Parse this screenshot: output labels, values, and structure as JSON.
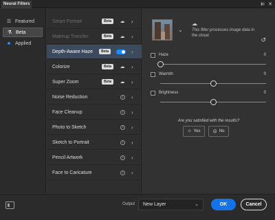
{
  "window": {
    "title": "Neural Filters",
    "menu_icon": "⇇",
    "close_icon": "✕"
  },
  "sidebar": {
    "items": [
      {
        "label": "Featured",
        "icon": "list-icon",
        "active": false
      },
      {
        "label": "Beta",
        "icon": "flask-icon",
        "active": true
      },
      {
        "label": "Applied",
        "icon": "dot-icon",
        "active": false
      }
    ]
  },
  "filters": [
    {
      "label": "Smart Portrait",
      "state": "badge-download",
      "badge": "Beta",
      "dim": true
    },
    {
      "label": "Makeup Transfer",
      "state": "badge-download",
      "badge": "Beta",
      "dim": true
    },
    {
      "label": "Depth-Aware Haze",
      "state": "badge-toggle",
      "badge": "Beta",
      "selected": true
    },
    {
      "label": "Colorize",
      "state": "badge-download",
      "badge": "Beta"
    },
    {
      "label": "Super Zoom",
      "state": "badge-download",
      "badge": "Beta"
    },
    {
      "label": "Noise Reduction",
      "state": "info"
    },
    {
      "label": "Face Cleanup",
      "state": "info"
    },
    {
      "label": "Photo to Sketch",
      "state": "info"
    },
    {
      "label": "Sketch to Portrait",
      "state": "info"
    },
    {
      "label": "Pencil Artwork",
      "state": "info"
    },
    {
      "label": "Face to Caricature",
      "state": "info"
    }
  ],
  "panel": {
    "cloud_note": "This filter processes image data in the cloud.",
    "sliders": [
      {
        "label": "Haze",
        "value": "0",
        "level": 0.0
      },
      {
        "label": "Warmth",
        "value": "0",
        "level": 0.5
      },
      {
        "label": "Brightness",
        "value": "0",
        "level": 0.5
      }
    ],
    "question": "Are you satisfied with the results?",
    "yes_label": "Yes",
    "no_label": "No"
  },
  "footer": {
    "output_label": "Output",
    "output_value": "New Layer",
    "ok_label": "OK",
    "cancel_label": "Cancel"
  },
  "colors": {
    "accent": "#1473e6",
    "toggle": "#1e8bff",
    "selected_row": "#3b4a5c"
  }
}
